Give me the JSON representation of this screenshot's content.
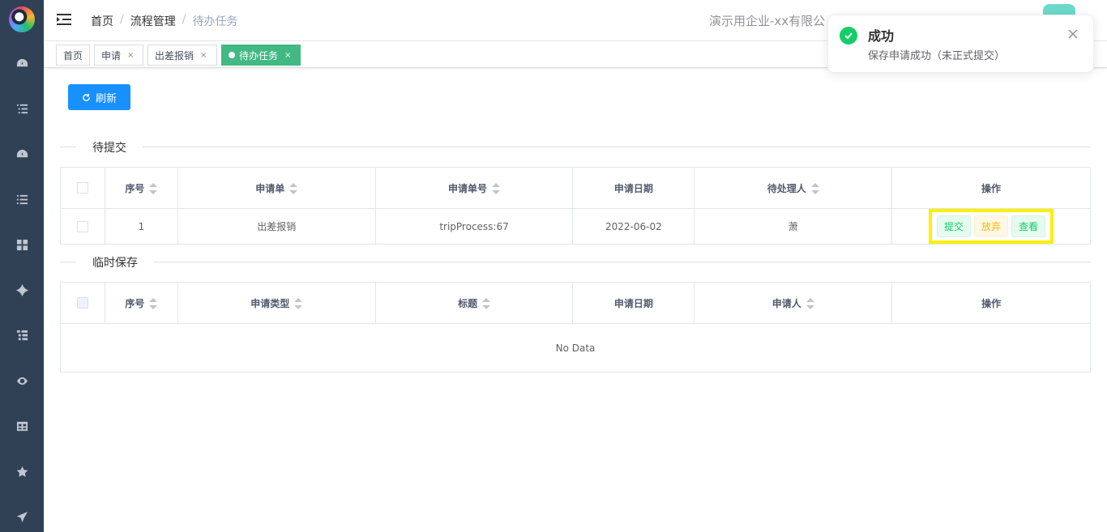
{
  "breadcrumb": [
    "首页",
    "流程管理",
    "待办任务"
  ],
  "company": "演示用企业-xx有限公",
  "tags": [
    {
      "label": "首页"
    },
    {
      "label": "申请"
    },
    {
      "label": "出差报销"
    },
    {
      "label": "待办任务"
    }
  ],
  "refresh_label": "刷新",
  "section1": {
    "title": "待提交",
    "columns": [
      "序号",
      "申请单",
      "申请单号",
      "申请日期",
      "待处理人",
      "操作"
    ],
    "rows": [
      {
        "index": "1",
        "form": "出差报销",
        "number": "tripProcess:67",
        "date": "2022-06-02",
        "handler": "萧"
      }
    ],
    "actions": {
      "submit": "提交",
      "abandon": "放弃",
      "view": "查看"
    }
  },
  "section2": {
    "title": "临时保存",
    "columns": [
      "序号",
      "申请类型",
      "标题",
      "申请日期",
      "申请人",
      "操作"
    ],
    "empty": "No Data"
  },
  "notification": {
    "title": "成功",
    "message": "保存申请成功（未正式提交）"
  },
  "colors": {
    "sidebar": "#304156",
    "primary": "#1890ff",
    "active_tag": "#42b983",
    "success": "#13ce66",
    "highlight": "#ffef00"
  }
}
